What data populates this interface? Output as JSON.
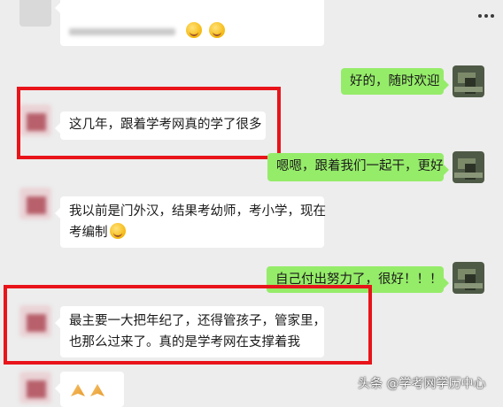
{
  "chat": {
    "messages": [
      {
        "side": "left",
        "text": "这几年，跟着学考网真的学了很多"
      },
      {
        "side": "right",
        "text": "好的，随时欢迎"
      },
      {
        "side": "right",
        "text": "嗯嗯，跟着我们一起干，更好"
      },
      {
        "side": "left",
        "line1": "我以前是门外汉，结果考幼师，考小学，现在",
        "line2": "考编制"
      },
      {
        "side": "right",
        "text": "自己付出努力了，很好！！！"
      },
      {
        "side": "left",
        "line1": "最主要一大把年纪了，还得管孩子，管家里，",
        "line2": "也那么过来了。真的是学考网在支撑着我"
      }
    ]
  },
  "header": {
    "more_icon": "more-dots-icon"
  },
  "watermark": {
    "text": "头条 @学考网学历中心"
  },
  "colors": {
    "background": "#ededed",
    "bubble_left": "#ffffff",
    "bubble_right": "#95ec69",
    "highlight": "#e8141a"
  }
}
